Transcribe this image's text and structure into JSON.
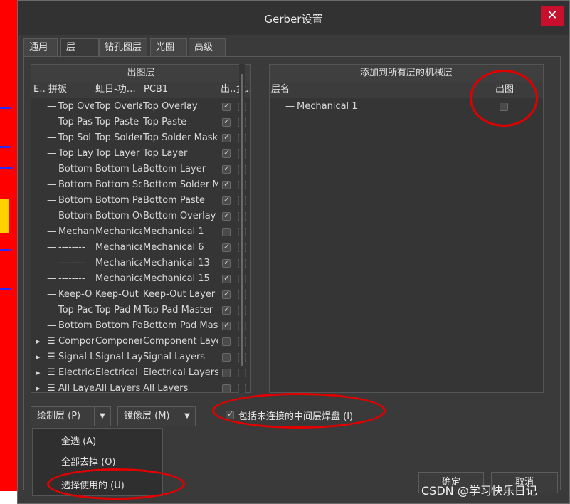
{
  "window": {
    "title": "Gerber设置",
    "close_glyph": "✕"
  },
  "tabs": [
    "通用",
    "层",
    "钻孔图层",
    "光圈",
    "高级"
  ],
  "left_grid": {
    "header": "出图层",
    "columns": [
      "E…",
      "拼板",
      "虹日-功…",
      "PCB1",
      "出…",
      "竟…"
    ],
    "rows": [
      {
        "prefix": "—",
        "name": "Top Ove",
        "panel": "Top Overla",
        "pcb": "Top Overlay",
        "plot": true,
        "mirror": false,
        "expand": false
      },
      {
        "prefix": "—",
        "name": "Top Pas",
        "panel": "Top Paste",
        "pcb": "Top Paste",
        "plot": true,
        "mirror": false,
        "expand": false
      },
      {
        "prefix": "—",
        "name": "Top Sol",
        "panel": "Top Solder",
        "pcb": "Top Solder Mask",
        "plot": true,
        "mirror": false,
        "expand": false
      },
      {
        "prefix": "—",
        "name": "Top Lay",
        "panel": "Top Layer",
        "pcb": "Top Layer",
        "plot": true,
        "mirror": false,
        "expand": false
      },
      {
        "prefix": "—",
        "name": "Bottom",
        "panel": "Bottom La",
        "pcb": "Bottom Layer",
        "plot": true,
        "mirror": false,
        "expand": false
      },
      {
        "prefix": "—",
        "name": "Bottom",
        "panel": "Bottom So",
        "pcb": "Bottom Solder M",
        "plot": true,
        "mirror": false,
        "expand": false
      },
      {
        "prefix": "—",
        "name": "Bottom",
        "panel": "Bottom Pa",
        "pcb": "Bottom Paste",
        "plot": true,
        "mirror": false,
        "expand": false
      },
      {
        "prefix": "—",
        "name": "Bottom",
        "panel": "Bottom Ov",
        "pcb": "Bottom Overlay",
        "plot": true,
        "mirror": false,
        "expand": false
      },
      {
        "prefix": "—",
        "name": "Mechan",
        "panel": "Mechanica",
        "pcb": "Mechanical 1",
        "plot": false,
        "mirror": false,
        "expand": false
      },
      {
        "prefix": "—",
        "name": "--------",
        "panel": "Mechanica",
        "pcb": "Mechanical 6",
        "plot": true,
        "mirror": false,
        "expand": false
      },
      {
        "prefix": "—",
        "name": "--------",
        "panel": "Mechanica",
        "pcb": "Mechanical 13",
        "plot": true,
        "mirror": false,
        "expand": false
      },
      {
        "prefix": "—",
        "name": "--------",
        "panel": "Mechanica",
        "pcb": "Mechanical 15",
        "plot": true,
        "mirror": false,
        "expand": false
      },
      {
        "prefix": "—",
        "name": "Keep-O",
        "panel": "Keep-Out",
        "pcb": "Keep-Out Layer",
        "plot": true,
        "mirror": false,
        "expand": false
      },
      {
        "prefix": "—",
        "name": "Top Pac",
        "panel": "Top Pad M",
        "pcb": "Top Pad Master",
        "plot": true,
        "mirror": false,
        "expand": false
      },
      {
        "prefix": "—",
        "name": "Bottom",
        "panel": "Bottom Pa",
        "pcb": "Bottom Pad Mast",
        "plot": true,
        "mirror": false,
        "expand": false
      },
      {
        "prefix": "☰",
        "name": "Compor",
        "panel": "Componer",
        "pcb": "Component Laye",
        "plot": false,
        "mirror": false,
        "expand": true
      },
      {
        "prefix": "☰",
        "name": "Signal L",
        "panel": "Signal Laye",
        "pcb": "Signal Layers",
        "plot": false,
        "mirror": false,
        "expand": true
      },
      {
        "prefix": "☰",
        "name": "Electrica",
        "panel": "Electrical L",
        "pcb": "Electrical Layers",
        "plot": false,
        "mirror": false,
        "expand": true
      },
      {
        "prefix": "☰",
        "name": "All Laye",
        "panel": "All Layers",
        "pcb": "All Layers",
        "plot": false,
        "mirror": false,
        "expand": true
      }
    ]
  },
  "right_grid": {
    "header": "添加到所有层的机械层",
    "col_name": "层名",
    "col_plot": "出图",
    "rows": [
      {
        "prefix": "—",
        "name": "Mechanical 1",
        "plot": false
      }
    ]
  },
  "buttons": {
    "plot_layers": "绘制层 (P)",
    "mirror_layers": "镜像层 (M)",
    "include_unconnected": "包括未连接的中间层焊盘 (I)",
    "include_unconnected_checked": true,
    "ok": "确定",
    "cancel": "取消"
  },
  "dropdown_menu": [
    "全选 (A)",
    "全部去掉 (O)",
    "选择使用的 (U)"
  ],
  "watermark": "CSDN @学习快乐日记"
}
